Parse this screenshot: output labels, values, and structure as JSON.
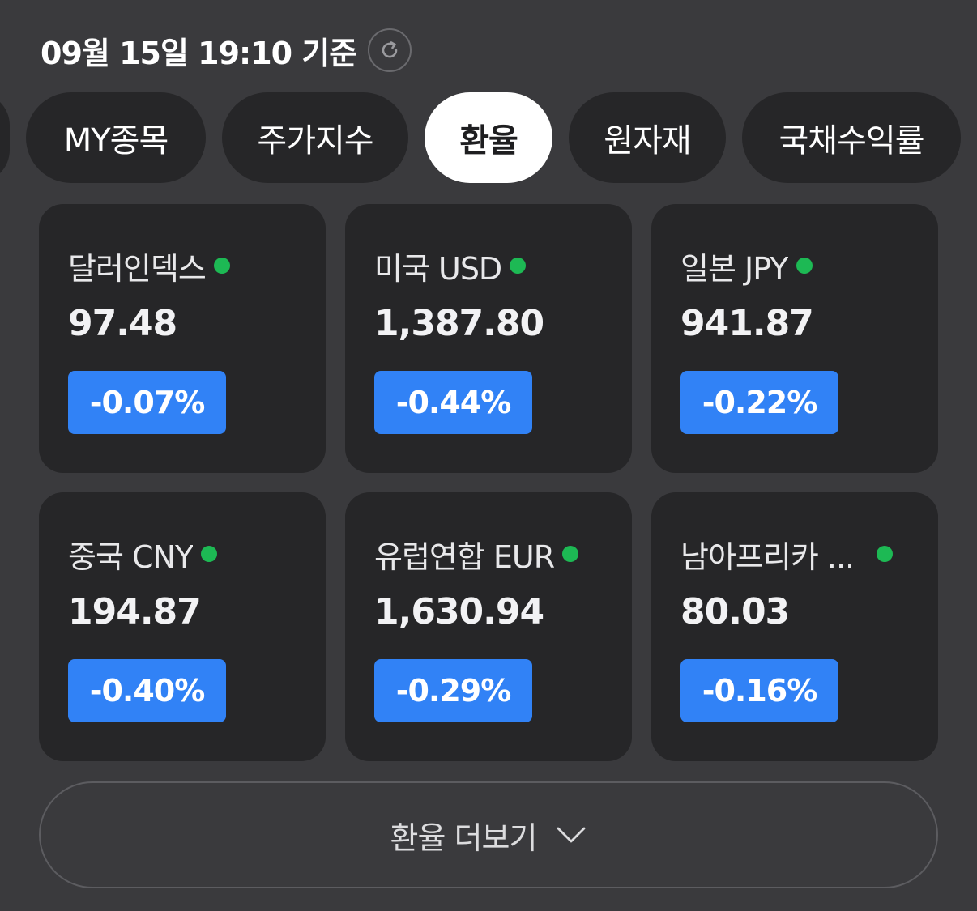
{
  "header": {
    "timestamp": "09월 15일 19:10 기준",
    "refresh_icon": "refresh-icon"
  },
  "tabs": [
    {
      "label": "MY종목"
    },
    {
      "label": "주가지수"
    },
    {
      "label": "환율",
      "active": true
    },
    {
      "label": "원자재"
    },
    {
      "label": "국채수익률"
    }
  ],
  "cards": [
    {
      "name": "달러인덱스",
      "value": "97.48",
      "change": "-0.07%"
    },
    {
      "name": "미국 USD",
      "value": "1,387.80",
      "change": "-0.44%"
    },
    {
      "name": "일본 JPY",
      "value": "941.87",
      "change": "-0.22%"
    },
    {
      "name": "중국 CNY",
      "value": "194.87",
      "change": "-0.40%"
    },
    {
      "name": "유럽연합 EUR",
      "value": "1,630.94",
      "change": "-0.29%"
    },
    {
      "name": "남아프리카 ...",
      "value": "80.03",
      "change": "-0.16%"
    }
  ],
  "more_button": {
    "label": "환율 더보기",
    "icon": "chevron-down-icon"
  },
  "colors": {
    "background": "#3a3a3d",
    "card": "#262628",
    "change_badge": "#3182f6",
    "live_dot": "#1db954"
  }
}
